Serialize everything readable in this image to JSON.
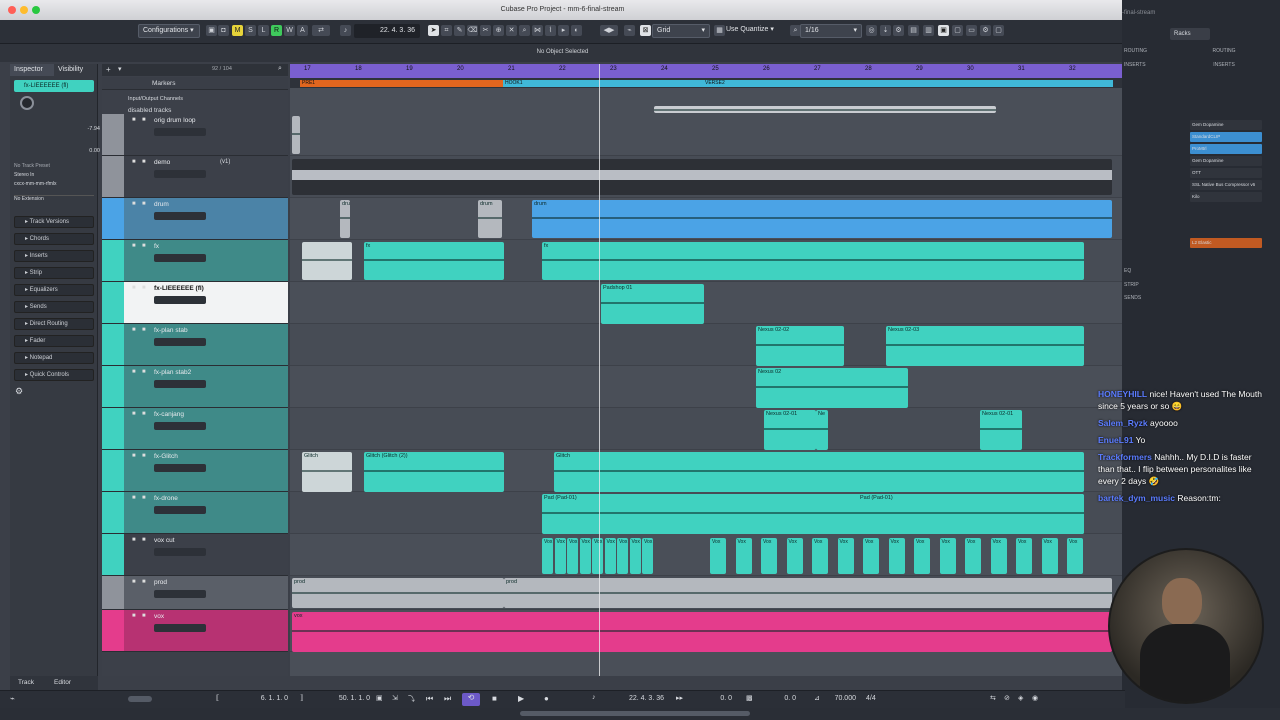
{
  "window": {
    "title": "Cubase Pro Project - mm-6-final-stream"
  },
  "toolbar": {
    "configurations": "Configurations",
    "m": "M",
    "s": "S",
    "l": "L",
    "r": "R",
    "w": "W",
    "a": "A",
    "time_display": "22. 4. 3. 36",
    "grid_label": "Grid",
    "quantize_label": "Use Quantize",
    "quantize_value": "1/16"
  },
  "info_line": "No Object Selected",
  "inspector": {
    "tab_inspector": "Inspector",
    "tab_visibility": "Visibility",
    "selected_track": "fx-LIEEEEEE (fl)",
    "gain_top": "-7.94",
    "gain_bottom": "0.00",
    "no_track_preset": "No Track Preset",
    "stereo_in": "Stereo In",
    "output_bus": "cxcx-mm-mm-rfmlx",
    "no_extension": "No Extension",
    "sections": [
      "Track Versions",
      "Chords",
      "Inserts",
      "Strip",
      "Equalizers",
      "Sends",
      "Direct Routing",
      "Fader",
      "Notepad",
      "Quick Controls"
    ],
    "bottom_tab_track": "Track",
    "bottom_tab_editor": "Editor"
  },
  "tracklist": {
    "counter": "92 / 104",
    "markers": "Markers",
    "io_channels": "Input/Output Channels",
    "disabled": "disabled tracks",
    "version_tag": "(v1)",
    "tracks": [
      "orig drum loop",
      "demo",
      "drum",
      "fx",
      "fx-LIEEEEEE (fl)",
      "fx-plan stab",
      "fx-plan stab2",
      "fx-canjang",
      "fx-Glitch",
      "fx-drone",
      "vox cut",
      "prod",
      "vox"
    ]
  },
  "ruler": {
    "bars": [
      "17",
      "18",
      "19",
      "20",
      "21",
      "22",
      "23",
      "24",
      "25",
      "26",
      "27",
      "28",
      "29",
      "30",
      "31",
      "32"
    ],
    "markers": [
      "PRE1",
      "HOOK1",
      "VERSE2"
    ]
  },
  "clips": {
    "drum_short": "dru",
    "drum_mid": "drum",
    "drum_long": "drum",
    "fx": "fx",
    "padshop": "Padshop 01",
    "nexus_02_02": "Nexus 02-02",
    "nexus_02_03": "Nexus 02-03",
    "nexus_02": "Nexus 02",
    "nexus_02_01a": "Nexus 02-01",
    "nexus_ne": "Ne",
    "nexus_02_01b": "Nexus 02-01",
    "glitch_a": "Glitch",
    "glitch_b": "Glitch (Glitch (2))",
    "glitch_c": "Glitch",
    "pad_a": "Pad (Pad-01)",
    "pad_b": "Pad (Pad-01)",
    "vox_cut": "Vox",
    "prod_a": "prod",
    "prod_b": "prod",
    "vox": "vox"
  },
  "transport": {
    "left_locator": "6. 1. 1. 0",
    "right_locator": "50. 1. 1. 0",
    "position": "22. 4. 3. 36",
    "offset": "0. 0",
    "tempo": "70.000",
    "signature": "4/4"
  },
  "right_panel": {
    "racks": "Racks",
    "routing": "ROUTING",
    "inserts": "INSERTS",
    "plugins": [
      "Gem Dopamine",
      "StandardCLIP",
      "ProMtrl",
      "Gem Dopamine",
      "OTT",
      "SSL Native Bus Compressor v6",
      "Kilo",
      "L2 Elastic"
    ],
    "eq": "EQ",
    "strip": "STRIP",
    "sends": "SENDS",
    "partial_title": "-final-stream"
  },
  "chat": [
    {
      "user": "HONEYHILL",
      "msg": "nice! Haven't used The Mouth since 5 years or so 😄",
      "color": "#5b7cff"
    },
    {
      "user": "Salem_Ryzk",
      "msg": "ayoooo",
      "color": "#5b7cff"
    },
    {
      "user": "EnueL91",
      "msg": "Yo",
      "color": "#5b7cff"
    },
    {
      "user": "Trackformers",
      "msg": "Nahhh.. My D.I.D is faster than that.. I flip between personalites like every 2 days 🤣",
      "color": "#5b7cff"
    },
    {
      "user": "bartek_dym_music",
      "msg": "Reason:tm:",
      "color": "#5b7cff"
    }
  ],
  "colors": {
    "ruler": "#7a5fd0",
    "teal": "#40d2c0",
    "blue": "#4ba3e6",
    "pink": "#e43c8c",
    "orange": "#e2661f",
    "gray": "#b4b8be"
  }
}
